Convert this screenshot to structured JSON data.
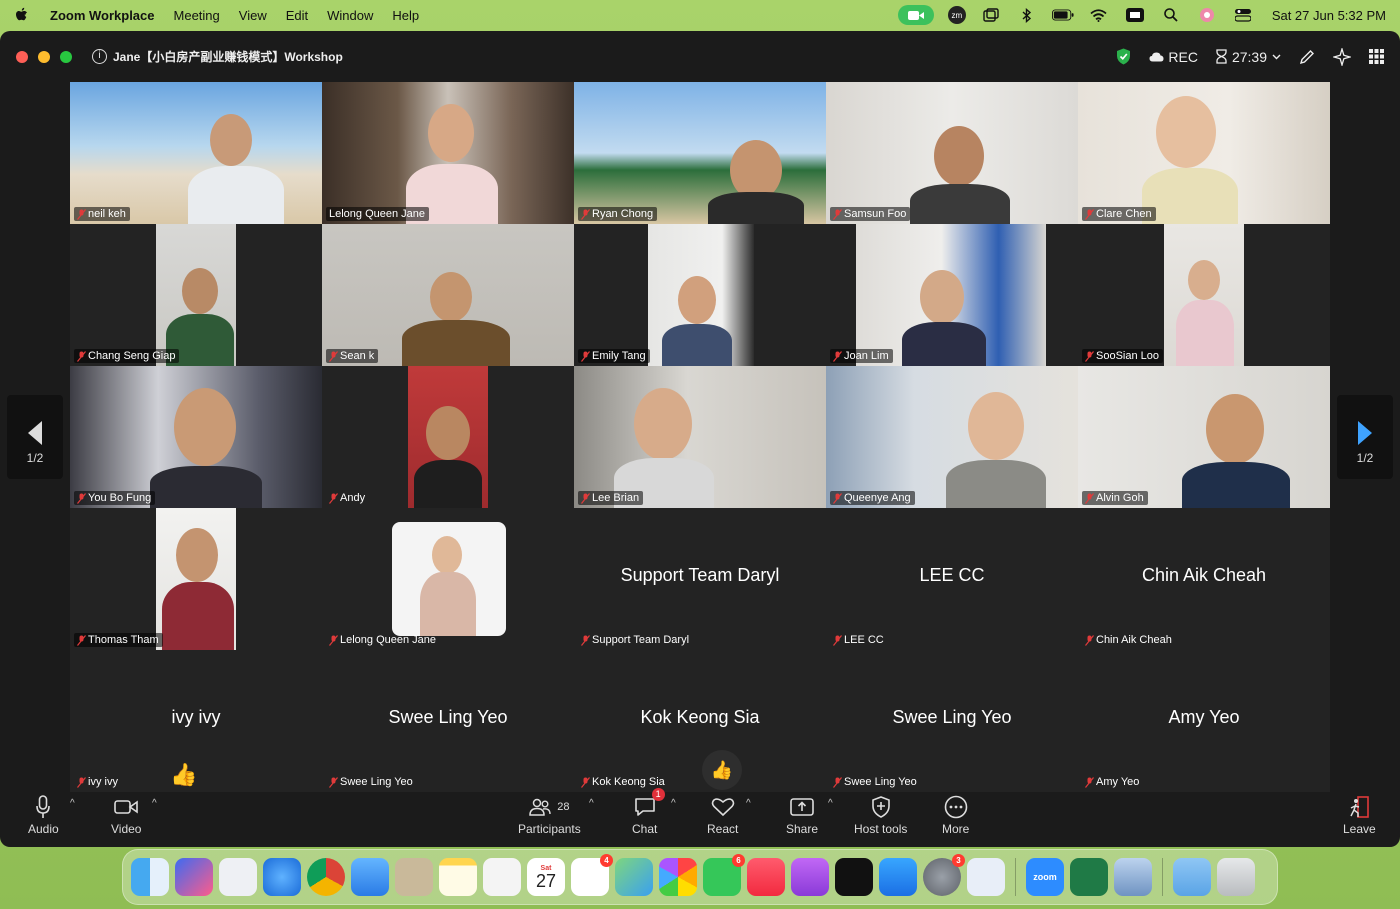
{
  "menubar": {
    "items": [
      "Zoom Workplace",
      "Meeting",
      "View",
      "Edit",
      "Window",
      "Help"
    ],
    "clock": "Sat 27 Jun  5:32 PM"
  },
  "window": {
    "title": "Jane【小白房产副业赚钱模式】Workshop",
    "rec_label": "REC",
    "timer": "27:39"
  },
  "tiles": [
    {
      "name": "neil keh"
    },
    {
      "name": "Lelong Queen Jane"
    },
    {
      "name": "Ryan Chong"
    },
    {
      "name": "Samsun Foo"
    },
    {
      "name": "Clare Chen"
    },
    {
      "name": "Chang Seng Giap"
    },
    {
      "name": "Sean k"
    },
    {
      "name": "Emily Tang"
    },
    {
      "name": "Joan Lim"
    },
    {
      "name": "SooSian Loo"
    },
    {
      "name": "You Bo Fung"
    },
    {
      "name": "Andy"
    },
    {
      "name": "Lee Brian"
    },
    {
      "name": "Queenye Ang"
    },
    {
      "name": "Alvin Goh"
    },
    {
      "name": "Thomas Tham"
    },
    {
      "name": "Lelong Queen Jane"
    },
    {
      "name": "Support Team Daryl",
      "display": "Support Team Daryl"
    },
    {
      "name": "LEE CC",
      "display": "LEE CC"
    },
    {
      "name": "Chin Aik Cheah",
      "display": "Chin Aik Cheah"
    },
    {
      "name": "ivy ivy",
      "display": "ivy ivy"
    },
    {
      "name": "Swee Ling Yeo",
      "display": "Swee Ling Yeo"
    },
    {
      "name": "Kok Keong Sia",
      "display": "Kok Keong Sia"
    },
    {
      "name": "Swee Ling Yeo",
      "display": "Swee Ling Yeo"
    },
    {
      "name": "Amy Yeo",
      "display": "Amy Yeo"
    }
  ],
  "pager": {
    "left": "1/2",
    "right": "1/2"
  },
  "toolbar": {
    "audio": "Audio",
    "video": "Video",
    "participants": "Participants",
    "participant_count": "28",
    "chat": "Chat",
    "chat_badge": "1",
    "react": "React",
    "share": "Share",
    "host_tools": "Host tools",
    "more": "More",
    "leave": "Leave"
  },
  "dock": {
    "calendar_month": "Sat",
    "calendar_day": "27",
    "badges": {
      "reminders": "4",
      "messages": "6",
      "settings": "3"
    },
    "zoom_label": "zoom"
  },
  "colors": {
    "speaking_border": "#3bb44a",
    "window_bg": "#1b1b1b",
    "desktop": "#9cc85c"
  }
}
